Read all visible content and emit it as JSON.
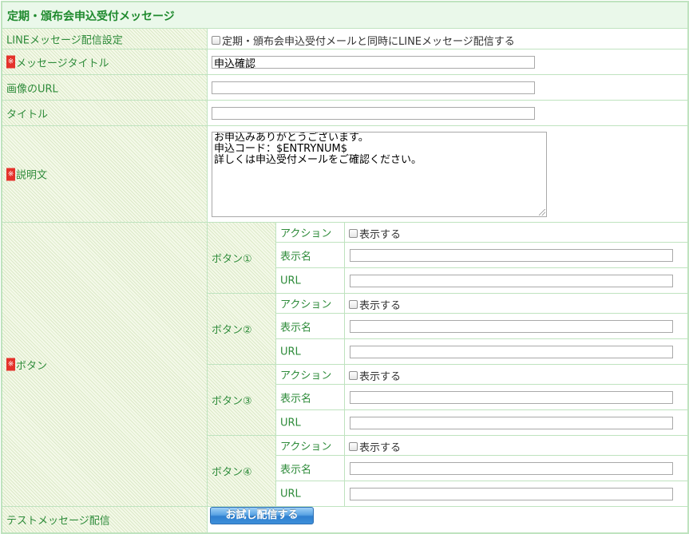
{
  "section": {
    "title": "定期・頒布会申込受付メッセージ"
  },
  "required_mark": "※",
  "line_setting": {
    "label": "LINEメッセージ配信設定",
    "checkbox_label": "定期・頒布会申込受付メールと同時にLINEメッセージ配信する",
    "checked": false
  },
  "message_title": {
    "label": "メッセージタイトル",
    "value": "申込確認"
  },
  "image_url": {
    "label": "画像のURL",
    "value": ""
  },
  "title": {
    "label": "タイトル",
    "value": ""
  },
  "description": {
    "label": "説明文",
    "value": "お申込みありがとうございます。\n申込コード：$ENTRYNUM$\n詳しくは申込受付メールをご確認ください。"
  },
  "buttons": {
    "label": "ボタン",
    "action_label": "アクション",
    "display_label": "表示名",
    "url_label": "URL",
    "show_label": "表示する",
    "items": [
      {
        "name": "ボタン①",
        "show": false,
        "display_name": "",
        "url": ""
      },
      {
        "name": "ボタン②",
        "show": false,
        "display_name": "",
        "url": ""
      },
      {
        "name": "ボタン③",
        "show": false,
        "display_name": "",
        "url": ""
      },
      {
        "name": "ボタン④",
        "show": false,
        "display_name": "",
        "url": ""
      }
    ]
  },
  "test_message": {
    "label": "テストメッセージ配信",
    "button_label": "お試し配信する"
  }
}
